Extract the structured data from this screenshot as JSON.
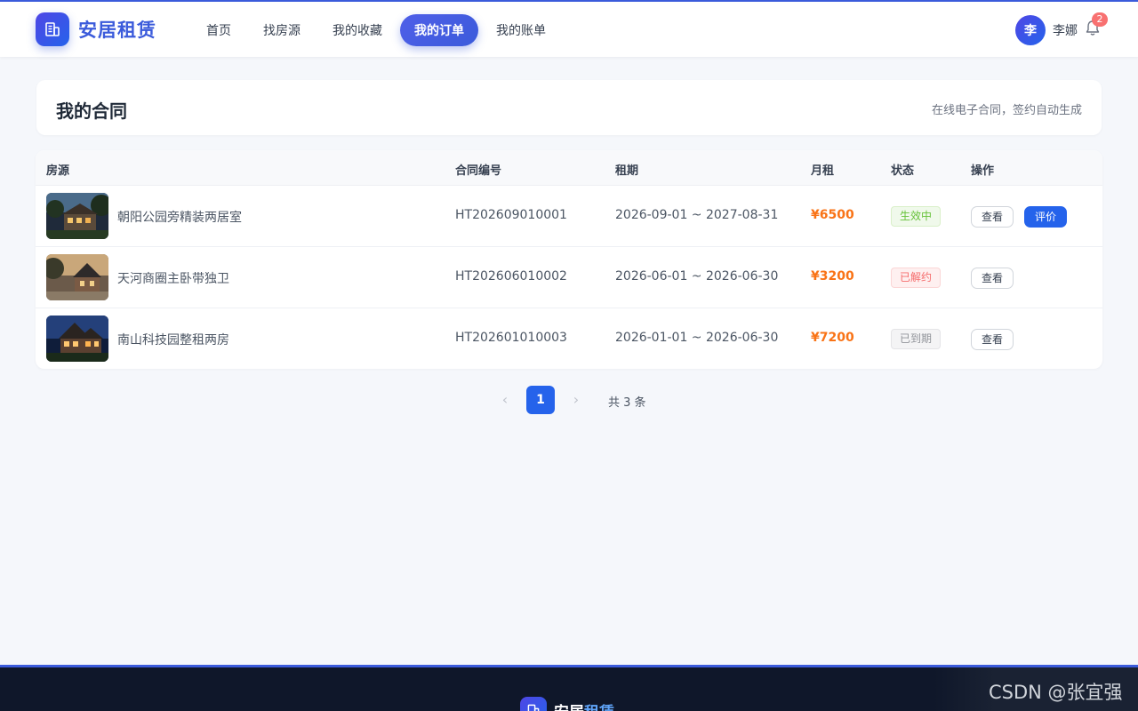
{
  "brand": {
    "name": "安居租赁",
    "footer_name_a": "安居",
    "footer_name_b": "租赁"
  },
  "nav": {
    "items": [
      {
        "label": "首页"
      },
      {
        "label": "找房源"
      },
      {
        "label": "我的收藏"
      },
      {
        "label": "我的订单"
      },
      {
        "label": "我的账单"
      }
    ],
    "active": "我的订单"
  },
  "user": {
    "avatar_char": "李",
    "name": "李娜",
    "notification_count": "2"
  },
  "page": {
    "title": "我的合同",
    "subtitle": "在线电子合同，签约自动生成"
  },
  "table": {
    "columns": [
      "房源",
      "合同编号",
      "租期",
      "月租",
      "状态",
      "操作"
    ],
    "rows": [
      {
        "property": "朝阳公园旁精装两居室",
        "contract_no": "HT202609010001",
        "term": "2026-09-01 ~ 2027-08-31",
        "rent": "¥6500",
        "status": "生效中",
        "status_kind": "active",
        "view_label": "查看",
        "review_label": "评价"
      },
      {
        "property": "天河商圈主卧带独卫",
        "contract_no": "HT202606010002",
        "term": "2026-06-01 ~ 2026-06-30",
        "rent": "¥3200",
        "status": "已解约",
        "status_kind": "cancel",
        "view_label": "查看"
      },
      {
        "property": "南山科技园整租两房",
        "contract_no": "HT202601010003",
        "term": "2026-01-01 ~ 2026-06-30",
        "rent": "¥7200",
        "status": "已到期",
        "status_kind": "expired",
        "view_label": "查看"
      }
    ]
  },
  "pagination": {
    "prev": "‹",
    "current": "1",
    "next": "›",
    "total_text": "共 3 条"
  },
  "watermark": "CSDN @张宜强",
  "colors": {
    "accent": "#3b5bdb",
    "primary_button": "#2563eb",
    "rent": "#f97316",
    "footer_bg": "#0f172a"
  }
}
